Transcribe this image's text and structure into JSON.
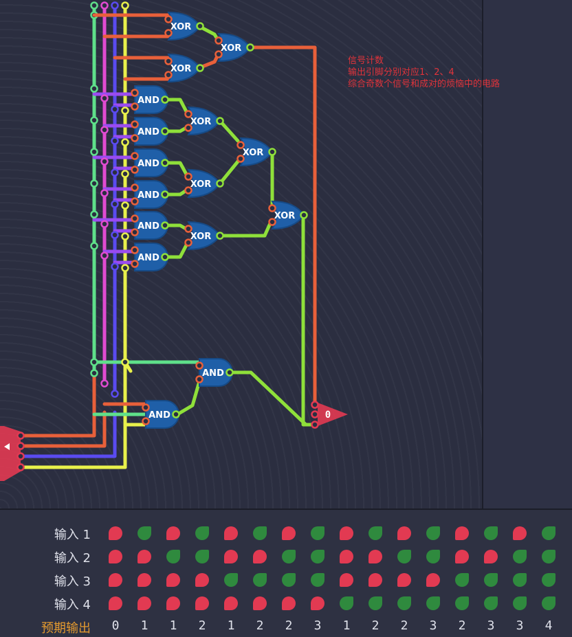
{
  "annotation": {
    "line1": "信号计数",
    "line2": "输出引脚分别对应1、2、4",
    "line3": "综合奇数个信号和成对的烦恼中的电路"
  },
  "gates": {
    "xor_label": "XOR",
    "and_label": "AND"
  },
  "output_pin": {
    "value": "0"
  },
  "colors": {
    "wire_green": "#5fe08a",
    "wire_magenta": "#e04bd1",
    "wire_blue": "#5a4bf0",
    "wire_yellow": "#e8f04b",
    "wire_orange": "#e8603a",
    "wire_lime": "#8fe03a",
    "wire_purple": "#9a4bf0",
    "gate_fill": "#1f5fa8",
    "pin_red": "#e23a52",
    "leaf_on": "#2f8a3e",
    "leaf_off": "#e23a52",
    "expected_label": "#e49a2f"
  },
  "truth_table": {
    "rows": [
      {
        "label": "输入 1",
        "values": [
          0,
          1,
          0,
          1,
          0,
          1,
          0,
          1,
          0,
          1,
          0,
          1,
          0,
          1,
          0,
          1
        ]
      },
      {
        "label": "输入 2",
        "values": [
          0,
          0,
          1,
          1,
          0,
          0,
          1,
          1,
          0,
          0,
          1,
          1,
          0,
          0,
          1,
          1
        ]
      },
      {
        "label": "输入 3",
        "values": [
          0,
          0,
          0,
          0,
          1,
          1,
          1,
          1,
          0,
          0,
          0,
          0,
          1,
          1,
          1,
          1
        ]
      },
      {
        "label": "输入 4",
        "values": [
          0,
          0,
          0,
          0,
          0,
          0,
          0,
          0,
          1,
          1,
          1,
          1,
          1,
          1,
          1,
          1
        ]
      }
    ],
    "expected_label": "预期输出",
    "expected_values": [
      "0",
      "1",
      "1",
      "2",
      "1",
      "2",
      "2",
      "3",
      "1",
      "2",
      "2",
      "3",
      "2",
      "3",
      "3",
      "4"
    ]
  }
}
